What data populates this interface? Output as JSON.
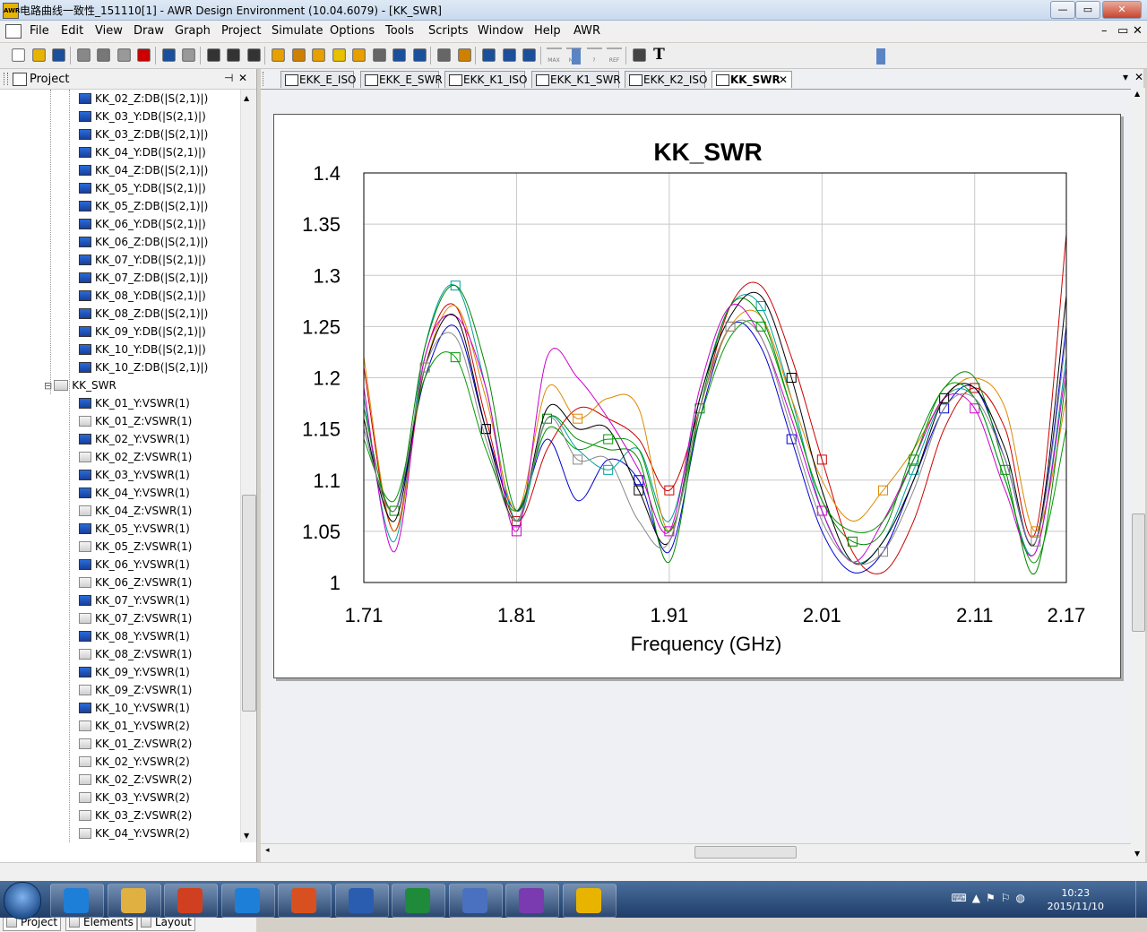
{
  "window": {
    "title": "电路曲线一致性_151110[1] - AWR Design Environment (10.04.6079) - [KK_SWR]",
    "app_icon_text": "AWR",
    "controls": {
      "minimize": "—",
      "maximize": "▭",
      "close": "✕"
    }
  },
  "menu": {
    "items": [
      "File",
      "Edit",
      "View",
      "Draw",
      "Graph",
      "Project",
      "Simulate",
      "Options",
      "Tools",
      "Scripts",
      "Window",
      "Help",
      "AWR"
    ],
    "right_controls": [
      "–",
      "▭",
      "✕"
    ]
  },
  "toolbar": {
    "icons": [
      "new-icon",
      "open-icon",
      "save-icon",
      "cut-icon",
      "copy-icon",
      "paste-icon",
      "delete-icon",
      "undo-icon",
      "redo-icon",
      "zoom-area-icon",
      "zoom-out-icon",
      "zoom-fit-icon",
      "add-schematic-icon",
      "add-graph-icon",
      "add-measurement-icon",
      "analyze-icon",
      "tune-icon",
      "tune-tool-icon",
      "add-doc-icon",
      "add-eqn-icon",
      "add-notes-icon",
      "optimize-icon",
      "yield-icon",
      "add-marker-icon",
      "add-line-marker-icon",
      "max-icon",
      "min-icon",
      "delta-icon",
      "ref-icon",
      "print-icon",
      "text-icon"
    ],
    "marker_labels": [
      "MAX",
      "MIN",
      "?",
      "REF"
    ],
    "text_tool": "T"
  },
  "project_pane": {
    "header": "Project",
    "pin": "ᵖ",
    "close": "✕",
    "tree": [
      {
        "label": "KK_02_Z:DB(|S(2,1)|)",
        "active": true,
        "level": 2
      },
      {
        "label": "KK_03_Y:DB(|S(2,1)|)",
        "active": true,
        "level": 2
      },
      {
        "label": "KK_03_Z:DB(|S(2,1)|)",
        "active": true,
        "level": 2
      },
      {
        "label": "KK_04_Y:DB(|S(2,1)|)",
        "active": true,
        "level": 2
      },
      {
        "label": "KK_04_Z:DB(|S(2,1)|)",
        "active": true,
        "level": 2
      },
      {
        "label": "KK_05_Y:DB(|S(2,1)|)",
        "active": true,
        "level": 2
      },
      {
        "label": "KK_05_Z:DB(|S(2,1)|)",
        "active": true,
        "level": 2
      },
      {
        "label": "KK_06_Y:DB(|S(2,1)|)",
        "active": true,
        "level": 2
      },
      {
        "label": "KK_06_Z:DB(|S(2,1)|)",
        "active": true,
        "level": 2
      },
      {
        "label": "KK_07_Y:DB(|S(2,1)|)",
        "active": true,
        "level": 2
      },
      {
        "label": "KK_07_Z:DB(|S(2,1)|)",
        "active": true,
        "level": 2
      },
      {
        "label": "KK_08_Y:DB(|S(2,1)|)",
        "active": true,
        "level": 2
      },
      {
        "label": "KK_08_Z:DB(|S(2,1)|)",
        "active": true,
        "level": 2
      },
      {
        "label": "KK_09_Y:DB(|S(2,1)|)",
        "active": true,
        "level": 2
      },
      {
        "label": "KK_10_Y:DB(|S(2,1)|)",
        "active": true,
        "level": 2
      },
      {
        "label": "KK_10_Z:DB(|S(2,1)|)",
        "active": true,
        "level": 2
      },
      {
        "label": "KK_SWR",
        "active": true,
        "level": 1,
        "expanded": true
      },
      {
        "label": "KK_01_Y:VSWR(1)",
        "active": true,
        "level": 2
      },
      {
        "label": "KK_01_Z:VSWR(1)",
        "active": false,
        "level": 2
      },
      {
        "label": "KK_02_Y:VSWR(1)",
        "active": true,
        "level": 2
      },
      {
        "label": "KK_02_Z:VSWR(1)",
        "active": false,
        "level": 2
      },
      {
        "label": "KK_03_Y:VSWR(1)",
        "active": true,
        "level": 2
      },
      {
        "label": "KK_04_Y:VSWR(1)",
        "active": true,
        "level": 2
      },
      {
        "label": "KK_04_Z:VSWR(1)",
        "active": false,
        "level": 2
      },
      {
        "label": "KK_05_Y:VSWR(1)",
        "active": true,
        "level": 2
      },
      {
        "label": "KK_05_Z:VSWR(1)",
        "active": false,
        "level": 2
      },
      {
        "label": "KK_06_Y:VSWR(1)",
        "active": true,
        "level": 2
      },
      {
        "label": "KK_06_Z:VSWR(1)",
        "active": false,
        "level": 2
      },
      {
        "label": "KK_07_Y:VSWR(1)",
        "active": true,
        "level": 2
      },
      {
        "label": "KK_07_Z:VSWR(1)",
        "active": false,
        "level": 2
      },
      {
        "label": "KK_08_Y:VSWR(1)",
        "active": true,
        "level": 2
      },
      {
        "label": "KK_08_Z:VSWR(1)",
        "active": false,
        "level": 2
      },
      {
        "label": "KK_09_Y:VSWR(1)",
        "active": true,
        "level": 2
      },
      {
        "label": "KK_09_Z:VSWR(1)",
        "active": false,
        "level": 2
      },
      {
        "label": "KK_10_Y:VSWR(1)",
        "active": true,
        "level": 2
      },
      {
        "label": "KK_01_Y:VSWR(2)",
        "active": false,
        "level": 2
      },
      {
        "label": "KK_01_Z:VSWR(2)",
        "active": false,
        "level": 2
      },
      {
        "label": "KK_02_Y:VSWR(2)",
        "active": false,
        "level": 2
      },
      {
        "label": "KK_02_Z:VSWR(2)",
        "active": false,
        "level": 2
      },
      {
        "label": "KK_03_Y:VSWR(2)",
        "active": false,
        "level": 2
      },
      {
        "label": "KK_03_Z:VSWR(2)",
        "active": false,
        "level": 2
      },
      {
        "label": "KK_04_Y:VSWR(2)",
        "active": false,
        "level": 2
      }
    ],
    "bottom_tabs": [
      "Project",
      "Elements",
      "Layout"
    ]
  },
  "doc_tabs": {
    "items": [
      "EKK_E_ISO",
      "EKK_E_SWR",
      "EKK_K1_ISO",
      "EKK_K1_SWR",
      "EKK_K2_ISO",
      "KK_SWR"
    ],
    "active": 5,
    "close": "✕",
    "dropdown": "▾",
    "window_close": "✕"
  },
  "chart_data": {
    "type": "line",
    "title": "KK_SWR",
    "xlabel": "Frequency (GHz)",
    "ylabel": "",
    "xlim": [
      1.71,
      2.17
    ],
    "ylim": [
      1.0,
      1.4
    ],
    "xticks": [
      1.71,
      1.81,
      1.91,
      2.01,
      2.11,
      2.17
    ],
    "xtick_labels": [
      "1.71",
      "1.81",
      "1.91",
      "2.01",
      "2.11",
      "2.17"
    ],
    "yticks": [
      1,
      1.05,
      1.1,
      1.15,
      1.2,
      1.25,
      1.3,
      1.35,
      1.4
    ],
    "ytick_labels": [
      "1",
      "1.05",
      "1.1",
      "1.15",
      "1.2",
      "1.25",
      "1.3",
      "1.35",
      "1.4"
    ],
    "grid": true,
    "legend": "none",
    "x": [
      1.71,
      1.73,
      1.75,
      1.77,
      1.79,
      1.81,
      1.83,
      1.85,
      1.87,
      1.89,
      1.91,
      1.93,
      1.95,
      1.97,
      1.99,
      2.01,
      2.03,
      2.05,
      2.07,
      2.09,
      2.11,
      2.13,
      2.15,
      2.17
    ],
    "series": [
      {
        "color": "#cc0000",
        "values": [
          1.21,
          1.05,
          1.22,
          1.27,
          1.16,
          1.06,
          1.13,
          1.17,
          1.16,
          1.14,
          1.09,
          1.17,
          1.27,
          1.29,
          1.22,
          1.12,
          1.03,
          1.01,
          1.06,
          1.15,
          1.19,
          1.15,
          1.05,
          1.34
        ]
      },
      {
        "color": "#0000cc",
        "values": [
          1.15,
          1.07,
          1.2,
          1.25,
          1.15,
          1.07,
          1.14,
          1.08,
          1.12,
          1.1,
          1.03,
          1.16,
          1.25,
          1.23,
          1.14,
          1.05,
          1.01,
          1.03,
          1.1,
          1.17,
          1.19,
          1.12,
          1.04,
          1.25
        ]
      },
      {
        "color": "#00a0a0",
        "values": [
          1.18,
          1.04,
          1.23,
          1.29,
          1.19,
          1.06,
          1.16,
          1.13,
          1.11,
          1.13,
          1.06,
          1.18,
          1.27,
          1.27,
          1.18,
          1.07,
          1.02,
          1.04,
          1.11,
          1.18,
          1.18,
          1.1,
          1.03,
          1.22
        ]
      },
      {
        "color": "#dd8800",
        "values": [
          1.22,
          1.05,
          1.21,
          1.27,
          1.18,
          1.07,
          1.19,
          1.16,
          1.18,
          1.17,
          1.05,
          1.17,
          1.25,
          1.26,
          1.18,
          1.1,
          1.06,
          1.09,
          1.13,
          1.18,
          1.2,
          1.17,
          1.05,
          1.18
        ]
      },
      {
        "color": "#008800",
        "values": [
          1.17,
          1.07,
          1.23,
          1.29,
          1.21,
          1.07,
          1.16,
          1.14,
          1.13,
          1.12,
          1.02,
          1.17,
          1.27,
          1.26,
          1.17,
          1.08,
          1.04,
          1.05,
          1.13,
          1.19,
          1.2,
          1.11,
          1.01,
          1.2
        ]
      },
      {
        "color": "#cc00cc",
        "values": [
          1.19,
          1.03,
          1.22,
          1.26,
          1.19,
          1.05,
          1.22,
          1.2,
          1.16,
          1.11,
          1.05,
          1.19,
          1.27,
          1.24,
          1.16,
          1.07,
          1.02,
          1.06,
          1.12,
          1.18,
          1.17,
          1.09,
          1.03,
          1.21
        ]
      },
      {
        "color": "#000000",
        "values": [
          1.16,
          1.06,
          1.21,
          1.26,
          1.15,
          1.06,
          1.17,
          1.15,
          1.15,
          1.09,
          1.04,
          1.18,
          1.26,
          1.28,
          1.2,
          1.09,
          1.02,
          1.04,
          1.1,
          1.18,
          1.19,
          1.13,
          1.04,
          1.28
        ]
      },
      {
        "color": "#009900",
        "values": [
          1.14,
          1.08,
          1.2,
          1.22,
          1.13,
          1.07,
          1.15,
          1.13,
          1.14,
          1.13,
          1.05,
          1.16,
          1.24,
          1.25,
          1.17,
          1.08,
          1.05,
          1.06,
          1.12,
          1.19,
          1.18,
          1.1,
          1.02,
          1.15
        ]
      },
      {
        "color": "#888888",
        "values": [
          1.15,
          1.07,
          1.21,
          1.24,
          1.14,
          1.06,
          1.16,
          1.12,
          1.12,
          1.06,
          1.04,
          1.17,
          1.25,
          1.24,
          1.15,
          1.06,
          1.02,
          1.03,
          1.09,
          1.17,
          1.18,
          1.12,
          1.04,
          1.24
        ]
      }
    ]
  },
  "taskbar": {
    "time": "10:23",
    "date": "2015/11/10",
    "apps": [
      "ie-icon",
      "explorer-icon",
      "office-icon",
      "ie2-icon",
      "outlook-icon",
      "word-icon",
      "excel-icon",
      "network-icon",
      "awr-logo-icon",
      "awr-app-icon"
    ]
  }
}
